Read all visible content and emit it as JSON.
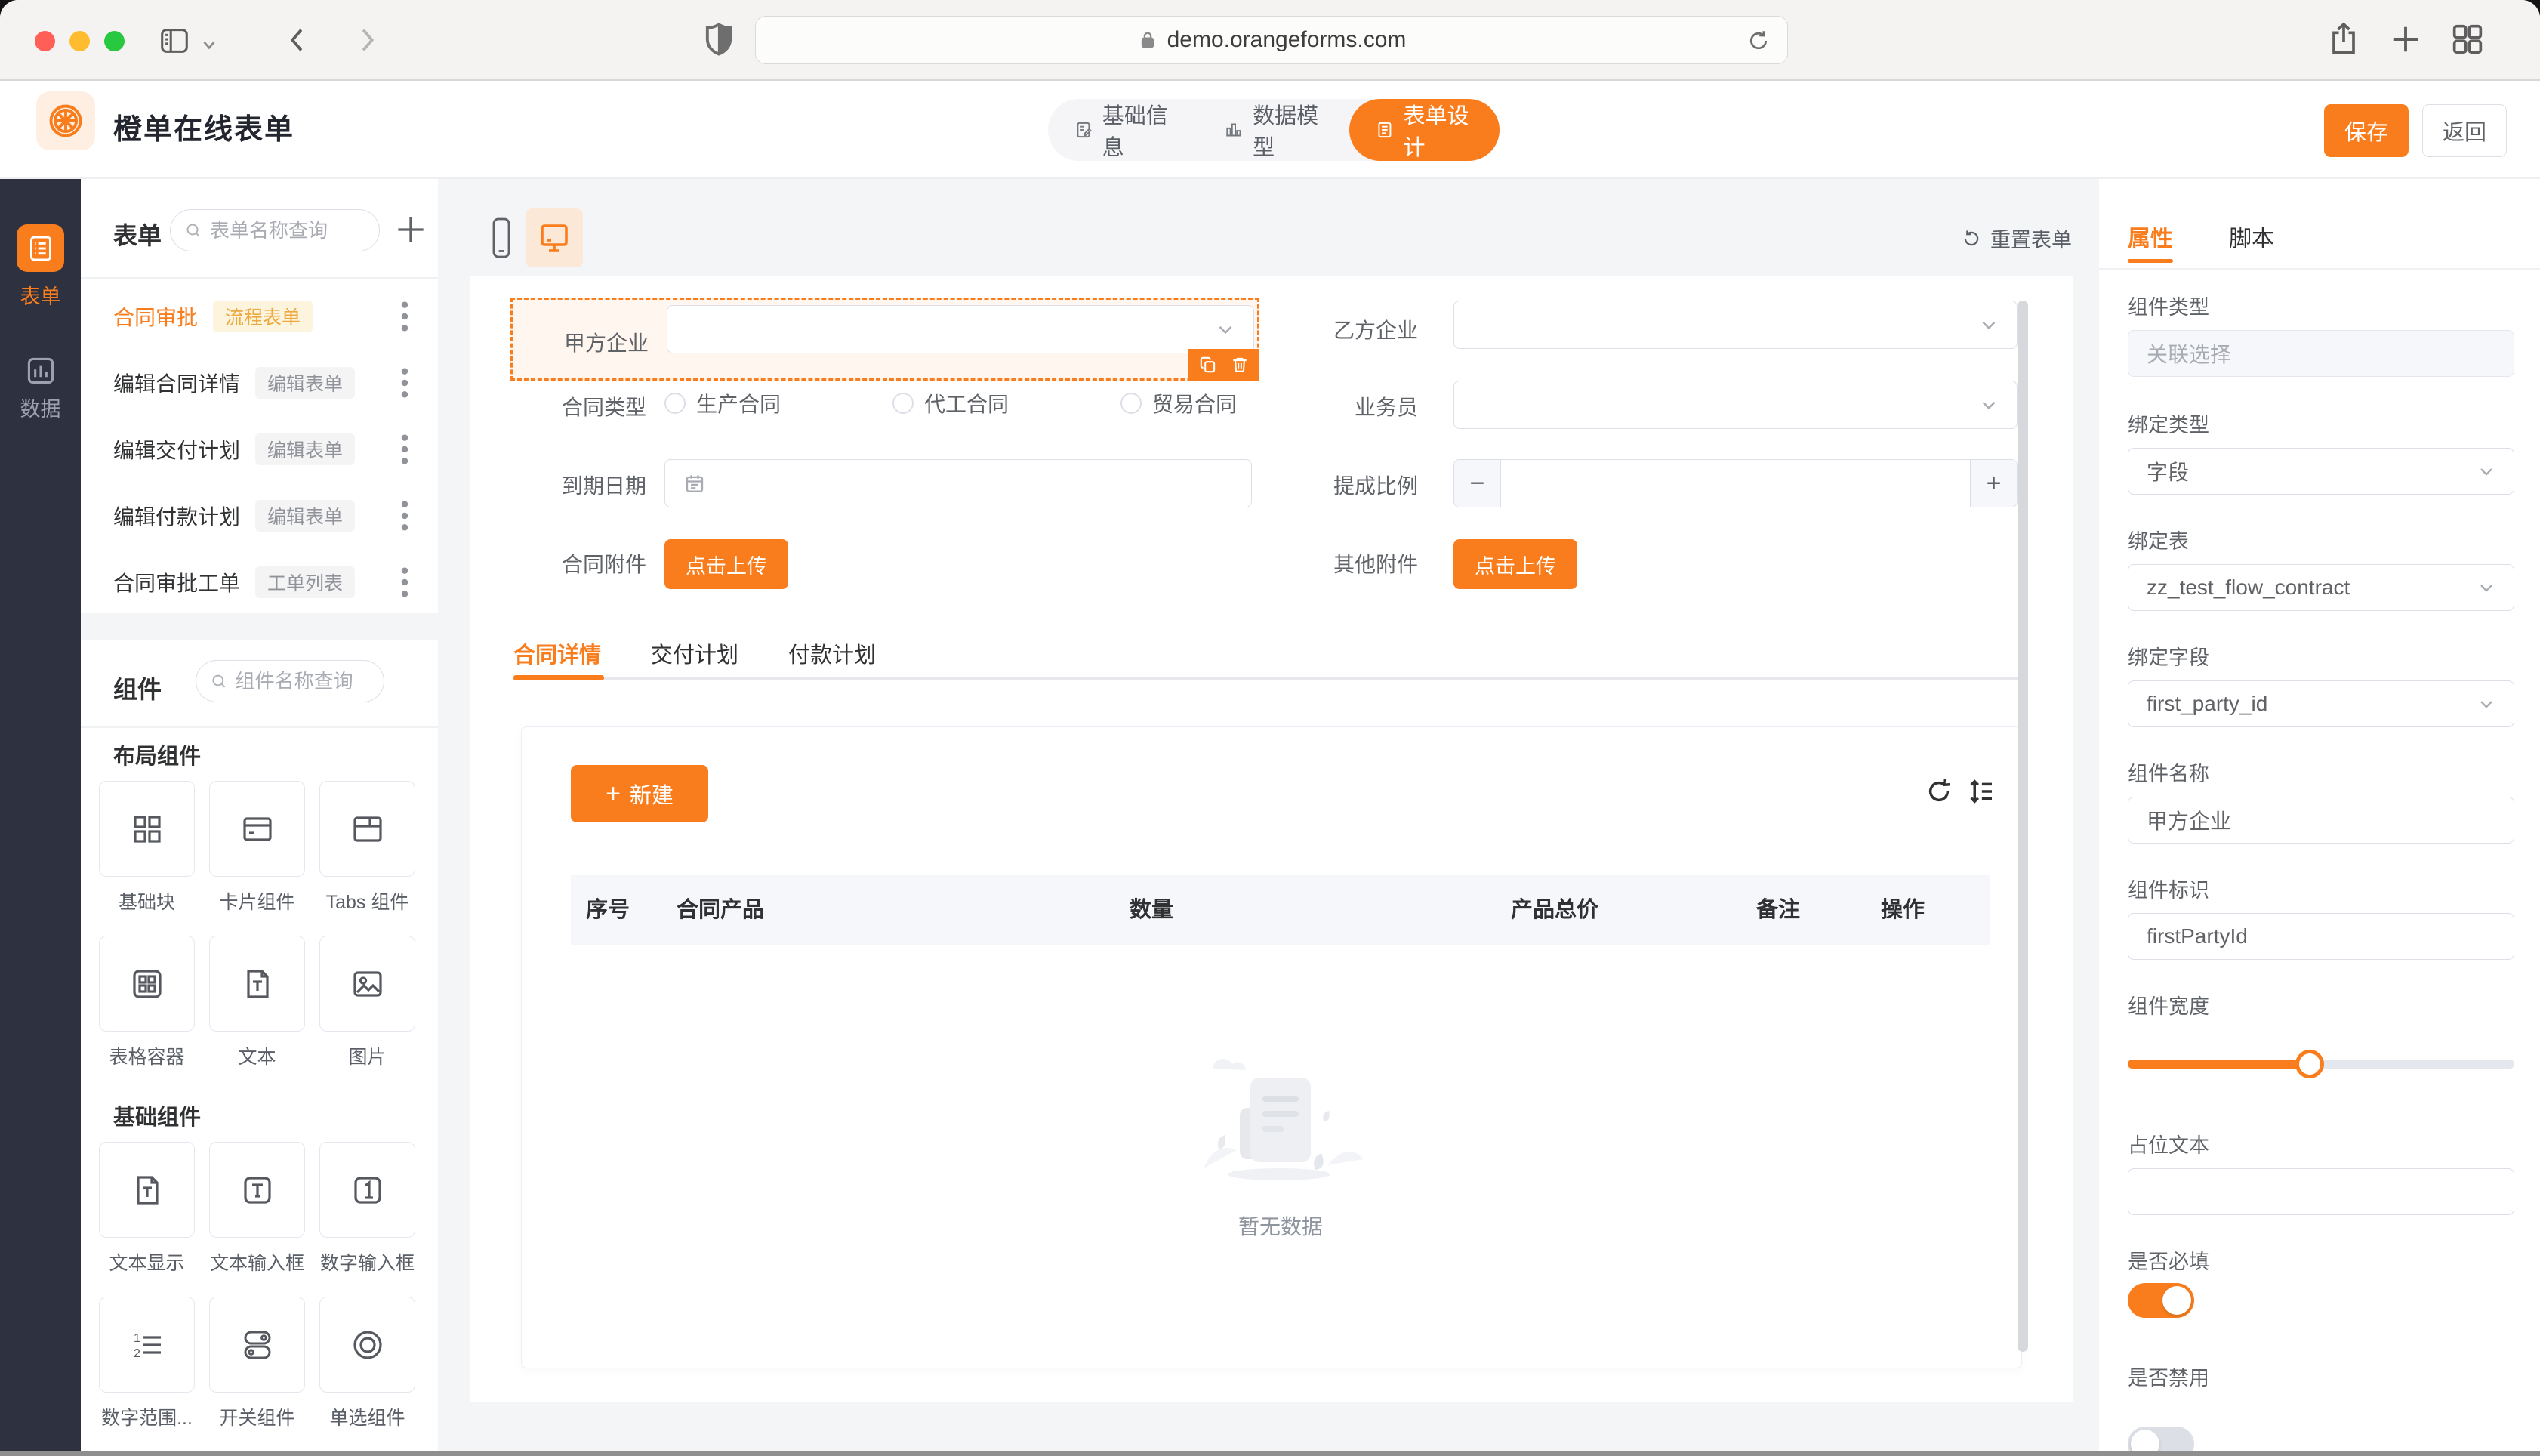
{
  "browser": {
    "url": "demo.orangeforms.com"
  },
  "icons": {
    "plus": "+",
    "minus": "−"
  },
  "header": {
    "app_title": "橙单在线表单",
    "nav_tabs": [
      {
        "label": "基础信息"
      },
      {
        "label": "数据模型"
      },
      {
        "label": "表单设计"
      }
    ],
    "save_label": "保存",
    "back_label": "返回"
  },
  "rail": {
    "items": [
      {
        "label": "表单"
      },
      {
        "label": "数据"
      }
    ]
  },
  "forms_panel": {
    "title": "表单",
    "search_placeholder": "表单名称查询",
    "items": [
      {
        "name": "合同审批",
        "badge": "流程表单"
      },
      {
        "name": "编辑合同详情",
        "badge": "编辑表单"
      },
      {
        "name": "编辑交付计划",
        "badge": "编辑表单"
      },
      {
        "name": "编辑付款计划",
        "badge": "编辑表单"
      },
      {
        "name": "合同审批工单",
        "badge": "工单列表"
      }
    ]
  },
  "components_panel": {
    "title": "组件",
    "search_placeholder": "组件名称查询",
    "groups": [
      {
        "title": "布局组件",
        "items": [
          {
            "label": "基础块"
          },
          {
            "label": "卡片组件"
          },
          {
            "label": "Tabs 组件"
          },
          {
            "label": "表格容器"
          },
          {
            "label": "文本"
          },
          {
            "label": "图片"
          }
        ]
      },
      {
        "title": "基础组件",
        "items": [
          {
            "label": "文本显示"
          },
          {
            "label": "文本输入框"
          },
          {
            "label": "数字输入框"
          },
          {
            "label": "数字范围..."
          },
          {
            "label": "开关组件"
          },
          {
            "label": "单选组件"
          }
        ]
      }
    ]
  },
  "canvas": {
    "reset_label": "重置表单",
    "selected_field_label": "甲方企业",
    "fields": {
      "second_party_label": "乙方企业",
      "contract_type_label": "合同类型",
      "contract_type_options": [
        "生产合同",
        "代工合同",
        "贸易合同"
      ],
      "salesman_label": "业务员",
      "due_date_label": "到期日期",
      "commission_label": "提成比例",
      "contract_attachment_label": "合同附件",
      "other_attachment_label": "其他附件",
      "upload_label": "点击上传"
    },
    "detail_tabs": [
      "合同详情",
      "交付计划",
      "付款计划"
    ],
    "new_button_label": "新建",
    "table_columns": [
      "序号",
      "合同产品",
      "数量",
      "产品总价",
      "备注",
      "操作"
    ],
    "empty_text": "暂无数据"
  },
  "properties": {
    "tabs": [
      "属性",
      "脚本"
    ],
    "component_type": {
      "label": "组件类型",
      "placeholder": "关联选择"
    },
    "bind_type": {
      "label": "绑定类型",
      "value": "字段"
    },
    "bind_table": {
      "label": "绑定表",
      "value": "zz_test_flow_contract"
    },
    "bind_field": {
      "label": "绑定字段",
      "value": "first_party_id"
    },
    "component_name": {
      "label": "组件名称",
      "value": "甲方企业"
    },
    "component_key": {
      "label": "组件标识",
      "value": "firstPartyId"
    },
    "component_width": {
      "label": "组件宽度",
      "value_percent": 47
    },
    "placeholder_field": {
      "label": "占位文本",
      "value": ""
    },
    "required": {
      "label": "是否必填",
      "on": true
    },
    "disabled": {
      "label": "是否禁用",
      "on": false
    }
  },
  "colors": {
    "accent": "#F97D1C",
    "accent_light": "#FDEFE3",
    "warning_text": "#EDA93E",
    "warning_bg": "#FDF4DE",
    "rail_bg": "#2E3240"
  }
}
